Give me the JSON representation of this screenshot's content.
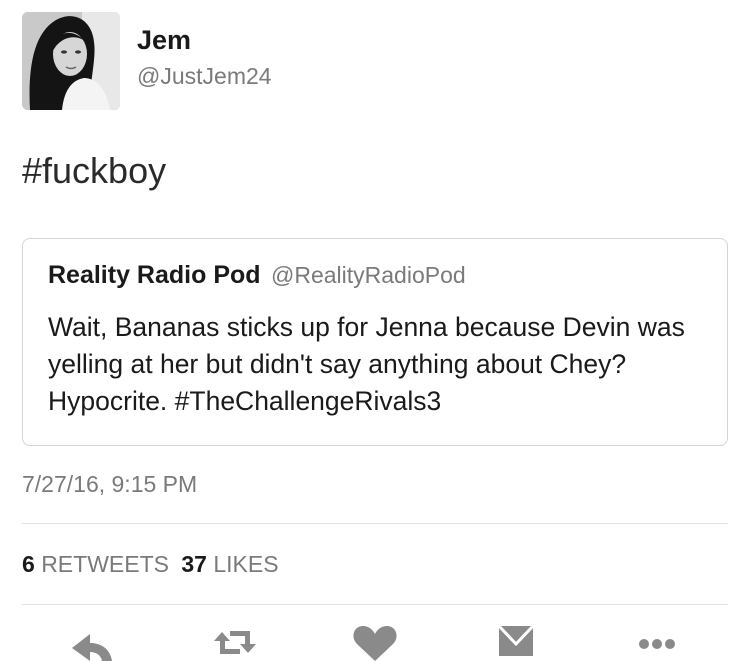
{
  "author": {
    "name": "Jem",
    "handle": "@JustJem24"
  },
  "tweet": {
    "text": "#fuckboy"
  },
  "quoted": {
    "name": "Reality Radio Pod",
    "handle": "@RealityRadioPod",
    "text": "Wait, Bananas sticks up for Jenna because Devin was yelling at her but didn't say anything about Chey? Hypocrite. #TheChallengeRivals3"
  },
  "timestamp": "7/27/16, 9:15 PM",
  "stats": {
    "retweets_count": "6",
    "retweets_label": "RETWEETS",
    "likes_count": "37",
    "likes_label": "LIKES"
  },
  "actions": [
    "reply-icon",
    "retweet-icon",
    "like-icon",
    "message-icon",
    "more-icon"
  ],
  "colors": {
    "text": "#1a1a1a",
    "muted": "#7a7a7a",
    "border": "#d4d4d4",
    "icon": "#8a8a8a"
  }
}
